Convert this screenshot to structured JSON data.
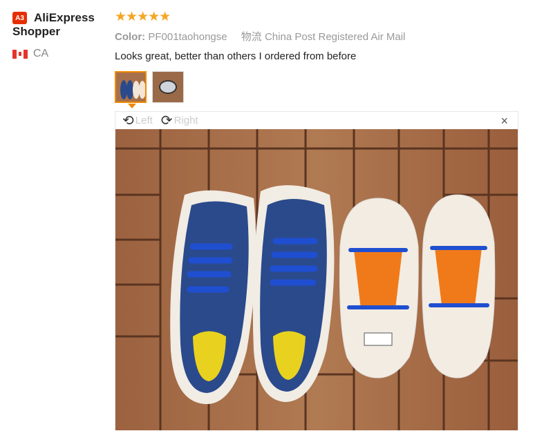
{
  "user": {
    "avatar_text": "A3",
    "name_line1": "AliExpress",
    "name_line2": "Shopper",
    "country": "CA",
    "flag": "canada-flag-icon"
  },
  "review": {
    "stars": "★★★★★",
    "color_label": "Color:",
    "color_value": "PF001taohongse",
    "shipping_label": "物流",
    "shipping_value": "China Post Registered Air Mail",
    "comment": "Looks great, better than others I ordered from before"
  },
  "viewer": {
    "left_label": "Left",
    "right_label": "Right",
    "close_label": "×"
  },
  "colors": {
    "accent": "#f08a00",
    "star": "#f5a623",
    "avatar": "#e62e04",
    "laces": "#1f4fd0",
    "shoe": "#2b4a8c",
    "tag": "#f07a1a"
  }
}
